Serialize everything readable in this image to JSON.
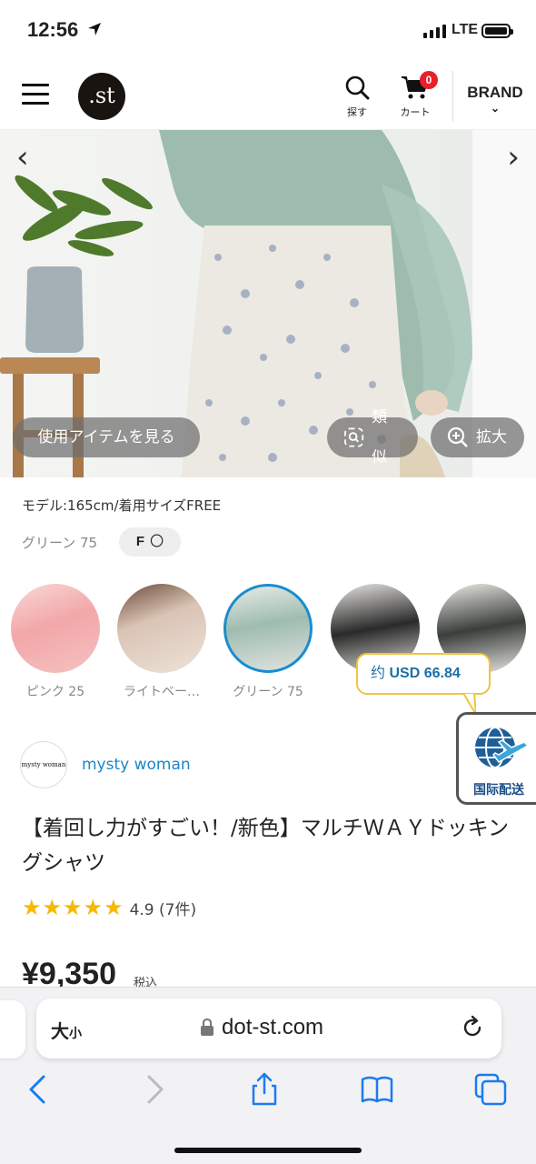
{
  "status": {
    "time": "12:56",
    "network": "LTE"
  },
  "header": {
    "search_label": "探す",
    "cart_label": "カート",
    "cart_count": "0",
    "brand_label": "BRAND",
    "logo_text": ".st"
  },
  "hero": {
    "view_items_label": "使用アイテムを見る",
    "similar_label": "類似",
    "zoom_label": "拡大"
  },
  "product": {
    "model_info": "モデル:165cm/着用サイズFREE",
    "selected_color": "グリーン 75",
    "size_label": "F",
    "size_stock": "〇",
    "shop_name": "mysty woman",
    "shop_logo_text": "mysty woman",
    "title": "【着回し力がすごい！/新色】マルチＷＡＹドッキングシャツ",
    "rating": "4.9 (7件)",
    "price": "¥9,350",
    "tax": "税込"
  },
  "swatches": [
    {
      "label": "ピンク 25",
      "color": "#f3a7a9"
    },
    {
      "label": "ライトベー…",
      "color": "#d9c4b5"
    },
    {
      "label": "グリーン 75",
      "color": "#9fbcb0"
    },
    {
      "label": "",
      "color": "#2a2a2a"
    },
    {
      "label": "",
      "color": "#3a3f3c"
    }
  ],
  "overlays": {
    "usd_prefix": "约",
    "usd_value": "USD 66.84",
    "intl_shipping": "国际配送"
  },
  "safari": {
    "text_size_big": "大",
    "text_size_small": "小",
    "url": "dot-st.com"
  },
  "colors": {
    "accent": "#1a8cd0",
    "badge": "#e8202a",
    "star": "#f6b900",
    "usd_border": "#f0c53a"
  }
}
